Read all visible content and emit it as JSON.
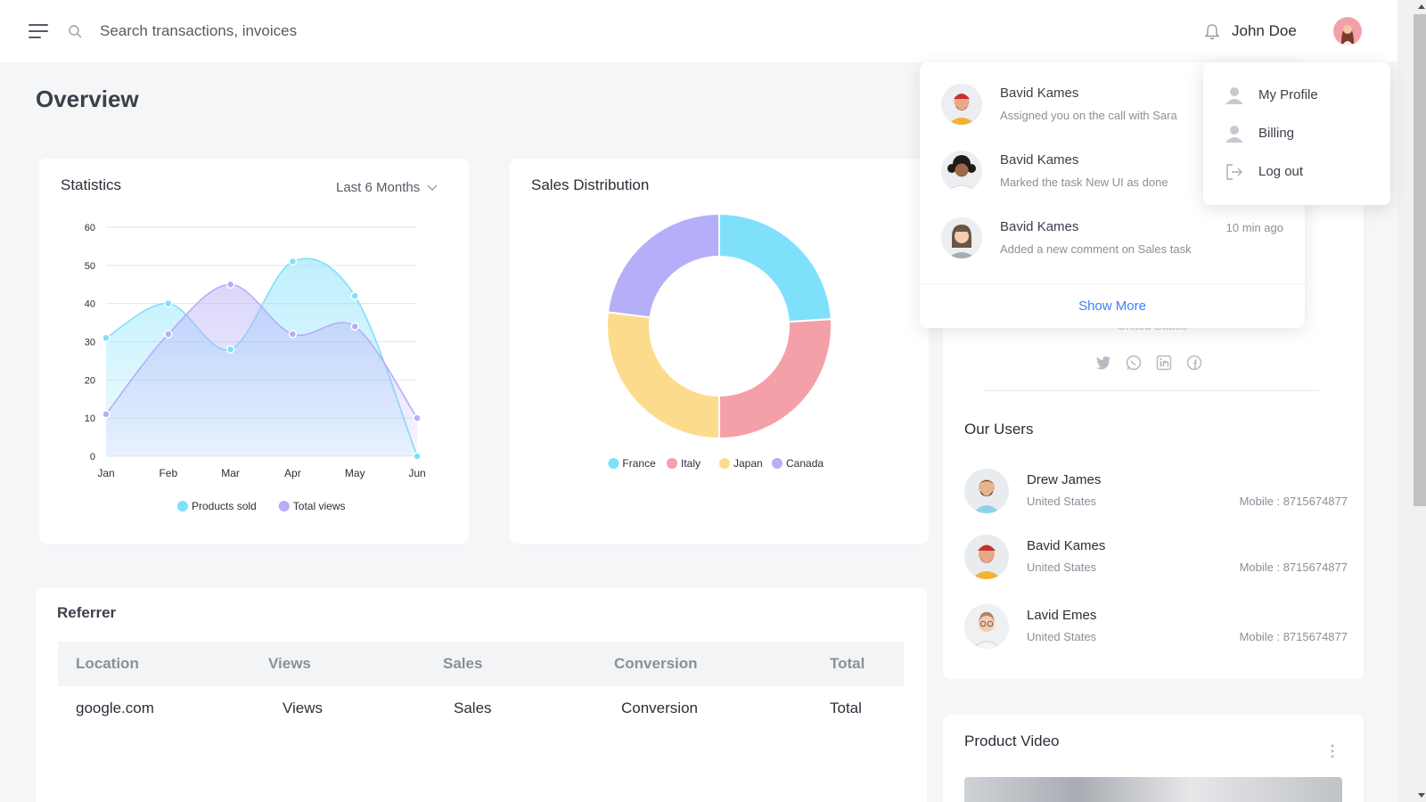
{
  "header": {
    "search_placeholder": "Search transactions, invoices",
    "username": "John Doe"
  },
  "page_title": "Overview",
  "statistics": {
    "title": "Statistics",
    "period": "Last 6 Months",
    "chart_data": {
      "type": "area",
      "x": [
        "Jan",
        "Feb",
        "Mar",
        "Apr",
        "May",
        "Jun"
      ],
      "ylim": [
        0,
        60
      ],
      "yticks": [
        "0",
        "10",
        "20",
        "30",
        "40",
        "50",
        "60"
      ],
      "grid": true,
      "legend_position": "bottom",
      "series": [
        {
          "name": "Products sold",
          "values": [
            31,
            40,
            28,
            51,
            42,
            0
          ],
          "color": "#7ee0fb"
        },
        {
          "name": "Total views",
          "values": [
            11,
            32,
            45,
            32,
            34,
            10
          ],
          "color": "#b5aef8"
        }
      ]
    }
  },
  "sales": {
    "title": "Sales Distribution",
    "chart_data": {
      "type": "pie",
      "legend_position": "bottom",
      "series": [
        {
          "name": "France",
          "value": 24,
          "color": "#7ee0fb"
        },
        {
          "name": "Italy",
          "value": 26,
          "color": "#f4a0a8"
        },
        {
          "name": "Japan",
          "value": 27,
          "color": "#fcdc8c"
        },
        {
          "name": "Canada",
          "value": 23,
          "color": "#b5aef8"
        }
      ]
    }
  },
  "referrer": {
    "title": "Referrer",
    "columns": [
      "Location",
      "Views",
      "Sales",
      "Conversion",
      "Total"
    ],
    "rows": [
      [
        "google.com",
        "Views",
        "Sales",
        "Conversion",
        "Total"
      ]
    ]
  },
  "profile": {
    "hidden_location": "United States"
  },
  "users": {
    "title": "Our Users",
    "items": [
      {
        "name": "Drew James",
        "location": "United States",
        "mobile": "Mobile : 8715674877"
      },
      {
        "name": "Bavid Kames",
        "location": "United States",
        "mobile": "Mobile : 8715674877"
      },
      {
        "name": "Lavid Emes",
        "location": "United States",
        "mobile": "Mobile : 8715674877"
      }
    ]
  },
  "video": {
    "title": "Product Video"
  },
  "notifications": {
    "items": [
      {
        "name": "Bavid Kames",
        "text": "Assigned you on the call with Sara",
        "time": ""
      },
      {
        "name": "Bavid Kames",
        "text": "Marked the task New UI as done",
        "time": ""
      },
      {
        "name": "Bavid Kames",
        "text": "Added a new comment on Sales task",
        "time": "10 min ago"
      }
    ],
    "show_more": "Show More"
  },
  "profile_menu": {
    "items": [
      {
        "label": "My Profile",
        "icon": "user-icon"
      },
      {
        "label": "Billing",
        "icon": "user-icon"
      },
      {
        "label": "Log out",
        "icon": "logout-icon"
      }
    ]
  },
  "colors": {
    "accent": "#3b82f6",
    "cyan": "#7ee0fb",
    "violet": "#b5aef8",
    "pink": "#f4a0a8",
    "yellow": "#fcdc8c"
  }
}
